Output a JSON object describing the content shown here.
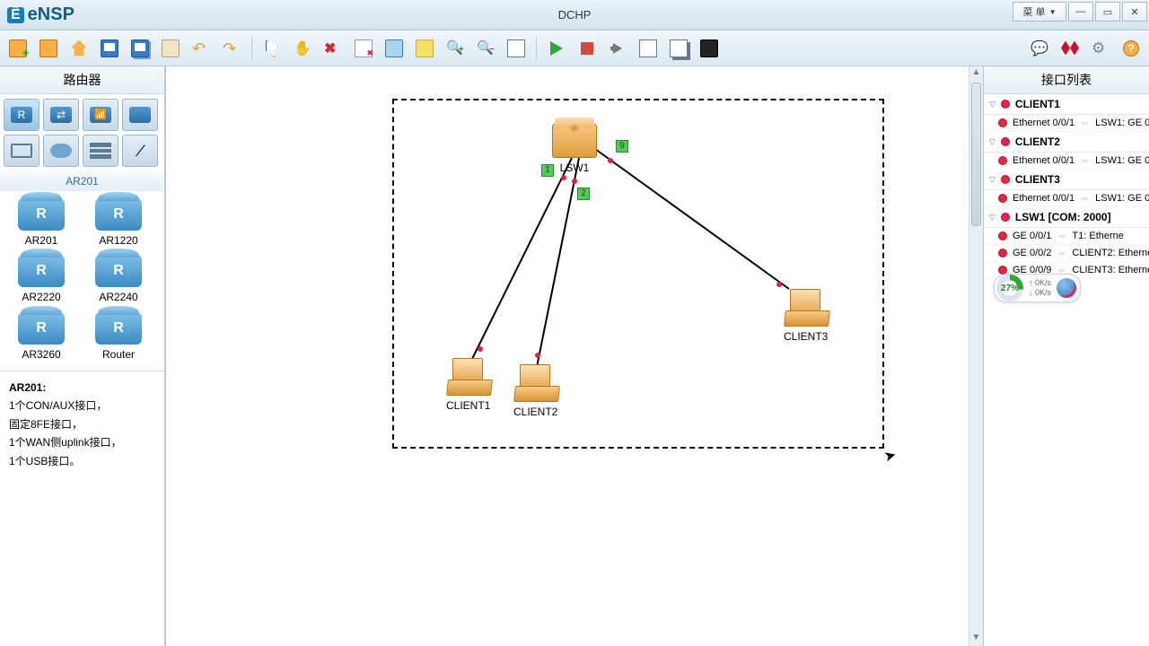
{
  "app_name": "eNSP",
  "window_title": "DCHP",
  "menu_label": "菜 单",
  "left": {
    "title": "路由器",
    "subtype": "AR201",
    "devices": [
      {
        "label": "AR201"
      },
      {
        "label": "AR1220"
      },
      {
        "label": "AR2220"
      },
      {
        "label": "AR2240"
      },
      {
        "label": "AR3260"
      },
      {
        "label": "Router"
      }
    ],
    "desc_title": "AR201:",
    "desc_lines": [
      "1个CON/AUX接口，",
      "固定8FE接口，",
      "1个WAN侧uplink接口，",
      "1个USB接口。"
    ]
  },
  "canvas": {
    "nodes": {
      "lsw1": "LSW1",
      "client1": "CLIENT1",
      "client2": "CLIENT2",
      "client3": "CLIENT3"
    },
    "ports": {
      "p1": "1",
      "p2": "2",
      "p9": "9"
    }
  },
  "right": {
    "title": "接口列表",
    "groups": [
      {
        "name": "CLIENT1",
        "ifaces": [
          {
            "local": "Ethernet 0/0/1",
            "remote": "LSW1: GE 0"
          }
        ]
      },
      {
        "name": "CLIENT2",
        "ifaces": [
          {
            "local": "Ethernet 0/0/1",
            "remote": "LSW1: GE 0"
          }
        ]
      },
      {
        "name": "CLIENT3",
        "ifaces": [
          {
            "local": "Ethernet 0/0/1",
            "remote": "LSW1: GE 0"
          }
        ]
      },
      {
        "name": "LSW1 [COM: 2000]",
        "ifaces": [
          {
            "local": "GE 0/0/1",
            "remote": "T1: Etherne"
          },
          {
            "local": "GE 0/0/2",
            "remote": "CLIENT2: Etherne"
          },
          {
            "local": "GE 0/0/9",
            "remote": "CLIENT3: Etherne"
          }
        ]
      }
    ]
  },
  "widget": {
    "percent": "27%",
    "up": "0K/s",
    "down": "0K/s"
  }
}
